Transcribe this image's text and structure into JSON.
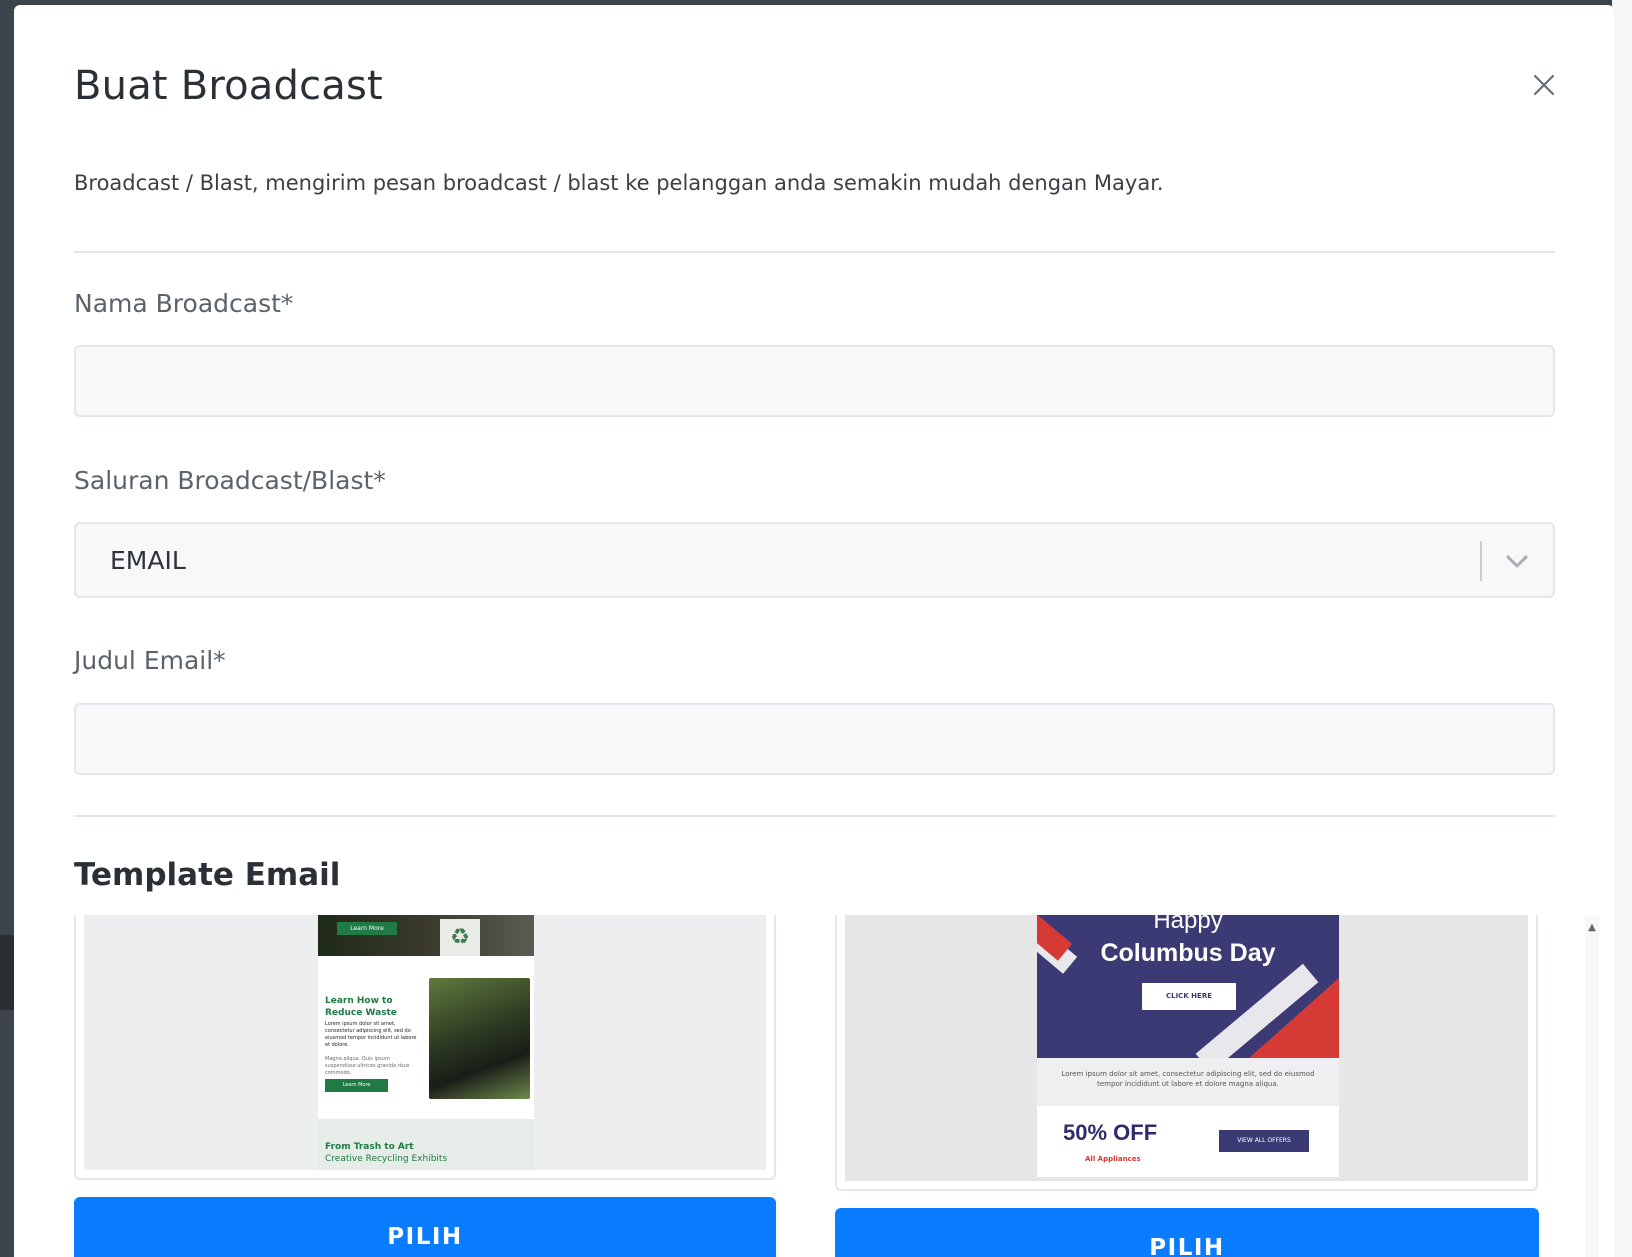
{
  "modal": {
    "title": "Buat Broadcast",
    "description": "Broadcast / Blast, mengirim pesan broadcast / blast ke pelanggan anda semakin mudah dengan Mayar."
  },
  "form": {
    "name_label": "Nama Broadcast*",
    "name_value": "",
    "channel_label": "Saluran Broadcast/Blast*",
    "channel_value": "EMAIL",
    "subject_label": "Judul Email*",
    "subject_value": ""
  },
  "templates": {
    "section_title": "Template Email",
    "items": [
      {
        "select_label": "PILIH",
        "preview": {
          "top_button": "Learn More",
          "heading": "Learn How to Reduce Waste",
          "body": "Lorem ipsum dolor sit amet, consectetur adipiscing elit, sed do eiusmod tempor incididunt ut labore et dolore.",
          "body2": "Magna aliqua. Quis ipsum suspendisse ultrices gravida risus commodo.",
          "button": "Learn More",
          "footer_title": "From Trash to Art",
          "footer_sub": "Creative Recycling Exhibits"
        }
      },
      {
        "select_label": "PILIH",
        "preview": {
          "happy": "Happy",
          "title": "Columbus Day",
          "button": "CLICK HERE",
          "body": "Lorem ipsum dolor sit amet, consectetur adipiscing elit, sed do eiusmod tempor incididunt ut labore et dolore magna aliqua.",
          "offer": "50% OFF",
          "offer_sub": "All Appliances",
          "offer_button": "VIEW ALL OFFERS"
        }
      }
    ]
  },
  "colors": {
    "primary": "#0a7cff",
    "overlay": "#3d434b"
  },
  "icons": {
    "close": "close-icon",
    "dropdown": "chevron-down-icon",
    "scroll_up": "scroll-up-icon"
  }
}
